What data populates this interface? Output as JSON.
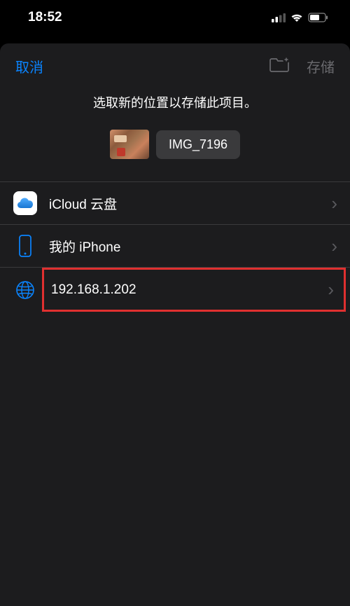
{
  "statusBar": {
    "time": "18:52"
  },
  "header": {
    "cancelLabel": "取消",
    "saveLabel": "存储"
  },
  "instruction": "选取新的位置以存储此项目。",
  "file": {
    "name": "IMG_7196"
  },
  "locations": [
    {
      "icon": "icloud",
      "label": "iCloud 云盘",
      "highlighted": false
    },
    {
      "icon": "iphone",
      "label": "我的 iPhone",
      "highlighted": false
    },
    {
      "icon": "globe",
      "label": "192.168.1.202",
      "highlighted": true
    }
  ]
}
